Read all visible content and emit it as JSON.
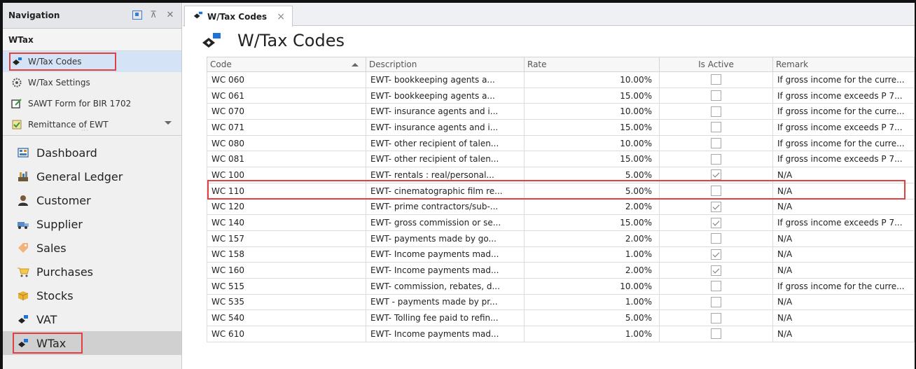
{
  "navigation": {
    "title": "Navigation",
    "group_title": "WTax",
    "sub_items": [
      {
        "label": "W/Tax Codes",
        "icon": "wtax-codes-icon",
        "selected": true
      },
      {
        "label": "W/Tax Settings",
        "icon": "settings-gear-icon",
        "selected": false
      },
      {
        "label": "SAWT Form for BIR 1702",
        "icon": "form-icon",
        "selected": false
      },
      {
        "label": "Remittance of EWT",
        "icon": "remittance-icon",
        "selected": false
      }
    ],
    "modules": [
      {
        "label": "Dashboard",
        "icon": "dashboard-icon"
      },
      {
        "label": "General Ledger",
        "icon": "ledger-icon"
      },
      {
        "label": "Customer",
        "icon": "customer-icon"
      },
      {
        "label": "Supplier",
        "icon": "supplier-icon"
      },
      {
        "label": "Sales",
        "icon": "sales-icon"
      },
      {
        "label": "Purchases",
        "icon": "purchases-icon"
      },
      {
        "label": "Stocks",
        "icon": "stocks-icon"
      },
      {
        "label": "VAT",
        "icon": "vat-icon"
      },
      {
        "label": "WTax",
        "icon": "wtax-icon",
        "selected": true
      }
    ]
  },
  "tab": {
    "label": "W/Tax Codes",
    "close": "×"
  },
  "page": {
    "title": "W/Tax Codes"
  },
  "grid": {
    "columns": [
      "Code",
      "Description",
      "Rate",
      "Is Active",
      "Remark"
    ],
    "rows": [
      {
        "code": "WC 060",
        "description": "EWT- bookkeeping agents a...",
        "rate": "10.00%",
        "active": false,
        "remark": "If gross income for the curre..."
      },
      {
        "code": "WC 061",
        "description": "EWT- bookkeeping agents a...",
        "rate": "15.00%",
        "active": false,
        "remark": "If gross income exceeds P 7..."
      },
      {
        "code": "WC 070",
        "description": "EWT- insurance agents and i...",
        "rate": "10.00%",
        "active": false,
        "remark": "If gross income for the curre..."
      },
      {
        "code": "WC 071",
        "description": "EWT- insurance agents and i...",
        "rate": "15.00%",
        "active": false,
        "remark": "If gross income exceeds P 7..."
      },
      {
        "code": "WC 080",
        "description": "EWT- other recipient of talen...",
        "rate": "10.00%",
        "active": false,
        "remark": "If gross income for the curre..."
      },
      {
        "code": "WC 081",
        "description": "EWT- other recipient of talen...",
        "rate": "15.00%",
        "active": false,
        "remark": "If gross income exceeds P 7..."
      },
      {
        "code": "WC 100",
        "description": "EWT- rentals : real/personal...",
        "rate": "5.00%",
        "active": true,
        "remark": "N/A"
      },
      {
        "code": "WC 110",
        "description": "EWT- cinematographic film re...",
        "rate": "5.00%",
        "active": false,
        "remark": "N/A"
      },
      {
        "code": "WC 120",
        "description": "EWT- prime contractors/sub-...",
        "rate": "2.00%",
        "active": true,
        "remark": "N/A"
      },
      {
        "code": "WC 140",
        "description": "EWT- gross commission or se...",
        "rate": "15.00%",
        "active": true,
        "remark": "If gross income exceeds P 7..."
      },
      {
        "code": "WC 157",
        "description": "EWT- payments made by go...",
        "rate": "2.00%",
        "active": false,
        "remark": "N/A"
      },
      {
        "code": "WC 158",
        "description": "EWT- Income payments mad...",
        "rate": "1.00%",
        "active": true,
        "remark": "N/A"
      },
      {
        "code": "WC 160",
        "description": "EWT- Income payments mad...",
        "rate": "2.00%",
        "active": true,
        "remark": "N/A"
      },
      {
        "code": "WC 515",
        "description": "EWT- commission, rebates, d...",
        "rate": "10.00%",
        "active": false,
        "remark": "If gross income for the curre..."
      },
      {
        "code": "WC 535",
        "description": "EWT - payments made by pr...",
        "rate": "1.00%",
        "active": false,
        "remark": "N/A"
      },
      {
        "code": "WC 540",
        "description": "EWT- Tolling fee paid to refin...",
        "rate": "5.00%",
        "active": false,
        "remark": "N/A"
      },
      {
        "code": "WC 610",
        "description": "EWT- Income payments mad...",
        "rate": "1.00%",
        "active": false,
        "remark": "N/A"
      }
    ]
  },
  "colors": {
    "highlight_border": "#e04040",
    "selected_bg": "#d4e3f5",
    "accent": "#3a7bd5"
  }
}
